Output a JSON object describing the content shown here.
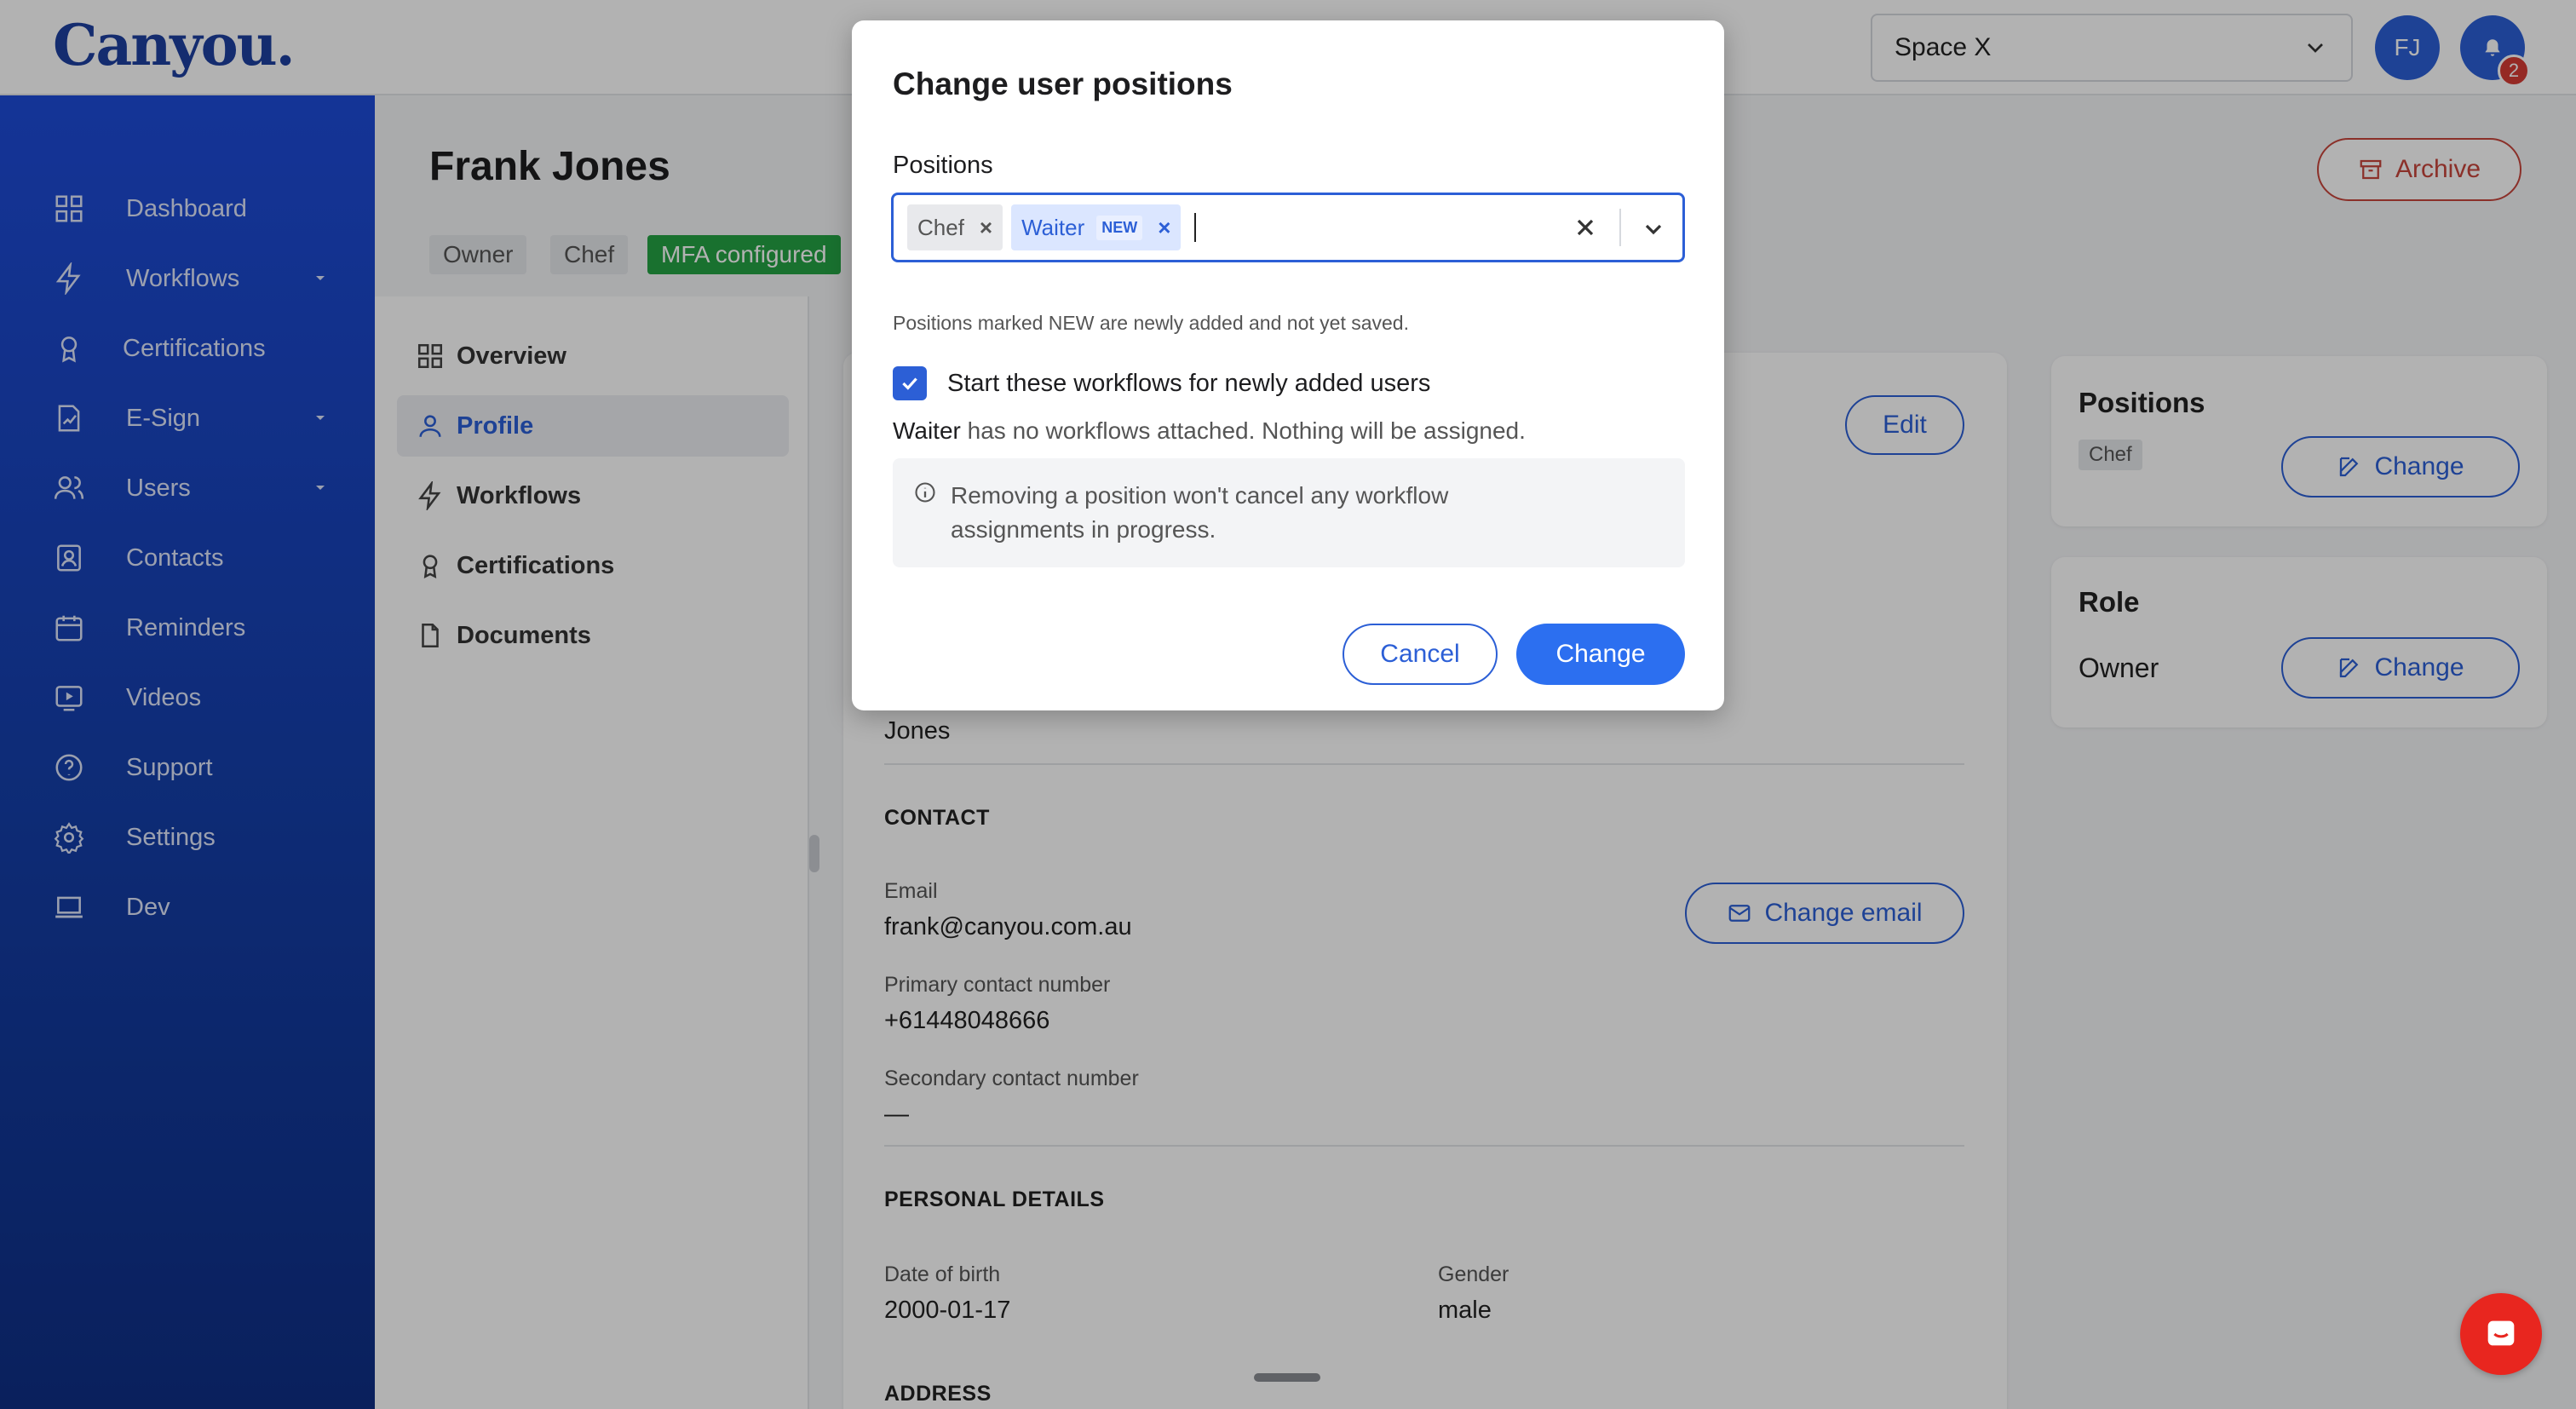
{
  "topbar": {
    "logo": "Canyou.",
    "space_select": "Space X",
    "avatar_initials": "FJ",
    "notification_count": "2"
  },
  "sidebar": {
    "items": [
      {
        "label": "Dashboard",
        "icon": "dashboard-icon"
      },
      {
        "label": "Workflows",
        "icon": "lightning-icon",
        "has_caret": true
      },
      {
        "label": "Certifications",
        "icon": "award-icon"
      },
      {
        "label": "E-Sign",
        "icon": "esign-icon",
        "has_caret": true
      },
      {
        "label": "Users",
        "icon": "users-icon",
        "has_caret": true
      },
      {
        "label": "Contacts",
        "icon": "contacts-icon"
      },
      {
        "label": "Reminders",
        "icon": "calendar-icon"
      },
      {
        "label": "Videos",
        "icon": "video-icon"
      },
      {
        "label": "Support",
        "icon": "help-icon"
      },
      {
        "label": "Settings",
        "icon": "gear-icon"
      },
      {
        "label": "Dev",
        "icon": "laptop-icon"
      }
    ]
  },
  "header": {
    "title": "Frank Jones",
    "tags": [
      "Owner",
      "Chef",
      "MFA configured"
    ],
    "archive_label": "Archive"
  },
  "subnav": {
    "items": [
      {
        "label": "Overview"
      },
      {
        "label": "Profile",
        "active": true
      },
      {
        "label": "Workflows"
      },
      {
        "label": "Certifications"
      },
      {
        "label": "Documents"
      }
    ]
  },
  "profile": {
    "edit_label": "Edit",
    "last_name": "Jones",
    "contact_section": "CONTACT",
    "email_label": "Email",
    "email_value": "frank@canyou.com.au",
    "change_email_label": "Change email",
    "primary_label": "Primary contact number",
    "primary_value": "+61448048666",
    "secondary_label": "Secondary contact number",
    "secondary_value": "—",
    "personal_section": "PERSONAL DETAILS",
    "dob_label": "Date of birth",
    "dob_value": "2000-01-17",
    "gender_label": "Gender",
    "gender_value": "male",
    "address_section": "ADDRESS"
  },
  "positions_card": {
    "title": "Positions",
    "tag": "Chef",
    "change_label": "Change"
  },
  "role_card": {
    "title": "Role",
    "value": "Owner",
    "change_label": "Change"
  },
  "modal": {
    "title": "Change user positions",
    "field_label": "Positions",
    "chips": [
      {
        "label": "Chef",
        "new": false
      },
      {
        "label": "Waiter",
        "new": true,
        "new_label": "NEW"
      }
    ],
    "hint": "Positions marked NEW are newly added and not yet saved.",
    "checkbox_label": "Start these workflows for newly added users",
    "checkbox_checked": true,
    "note_strong": "Waiter",
    "note_rest": " has no workflows attached. Nothing will be assigned.",
    "info_text": "Removing a position won't cancel any workflow assignments in progress.",
    "cancel_label": "Cancel",
    "change_label": "Change"
  },
  "colors": {
    "primary": "#2c5fd6",
    "danger": "#c7453c",
    "success": "#25a244",
    "sidebar_top": "#1e4bd8",
    "sidebar_bottom": "#0f2f85"
  }
}
